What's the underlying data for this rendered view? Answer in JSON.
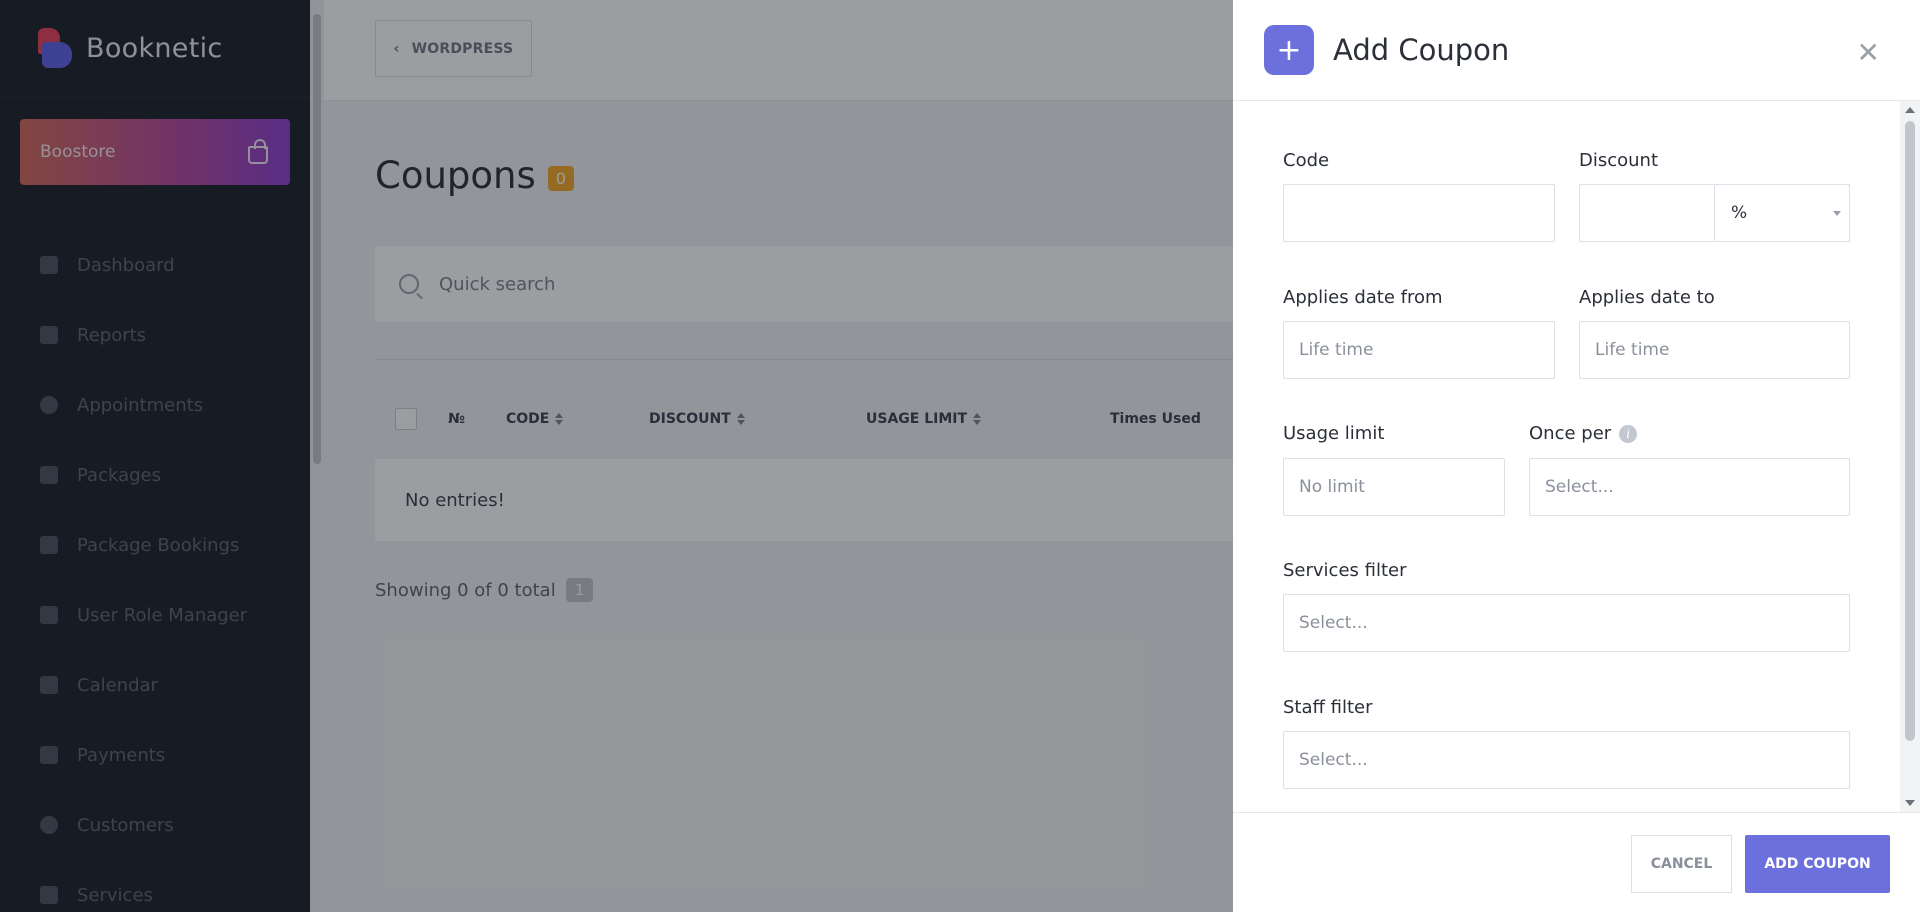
{
  "brand": {
    "name": "Booknetic"
  },
  "boostore": {
    "label": "Boostore"
  },
  "sidebar": {
    "items": [
      {
        "label": "Dashboard",
        "icon": "cube-icon"
      },
      {
        "label": "Reports",
        "icon": "chart-icon"
      },
      {
        "label": "Appointments",
        "icon": "clock-icon"
      },
      {
        "label": "Packages",
        "icon": "boxes-icon"
      },
      {
        "label": "Package Bookings",
        "icon": "box-open-icon"
      },
      {
        "label": "User Role Manager",
        "icon": "user-plus-icon"
      },
      {
        "label": "Calendar",
        "icon": "calendar-icon"
      },
      {
        "label": "Payments",
        "icon": "wallet-icon"
      },
      {
        "label": "Customers",
        "icon": "users-icon"
      },
      {
        "label": "Services",
        "icon": "list-icon"
      }
    ]
  },
  "topbar": {
    "back_label": "WORDPRESS"
  },
  "page": {
    "title": "Coupons",
    "count": "0"
  },
  "search": {
    "placeholder": "Quick search"
  },
  "table": {
    "columns": [
      "№",
      "CODE",
      "DISCOUNT",
      "USAGE LIMIT",
      "Times Used"
    ],
    "empty": "No entries!"
  },
  "pagination": {
    "summary": "Showing 0 of 0 total",
    "page": "1"
  },
  "drawer": {
    "title": "Add Coupon",
    "code_label": "Code",
    "discount_label": "Discount",
    "discount_type": "%",
    "date_from_label": "Applies date from",
    "date_from_placeholder": "Life time",
    "date_to_label": "Applies date to",
    "date_to_placeholder": "Life time",
    "usage_limit_label": "Usage limit",
    "usage_limit_placeholder": "No limit",
    "once_per_label": "Once per",
    "once_per_placeholder": "Select...",
    "services_label": "Services filter",
    "services_placeholder": "Select...",
    "staff_label": "Staff filter",
    "staff_placeholder": "Select...",
    "cancel": "CANCEL",
    "submit": "ADD COUPON"
  },
  "colors": {
    "accent": "#6c70dc",
    "sidebar": "#1b1f29",
    "badge": "#f3a827"
  }
}
